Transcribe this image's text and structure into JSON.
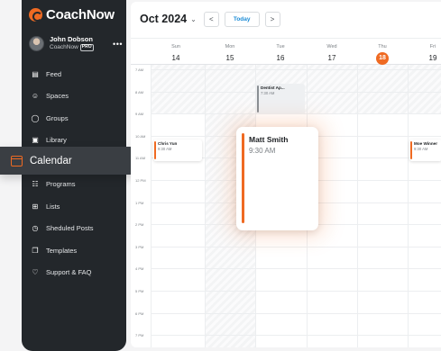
{
  "brand": {
    "name": "CoachNow"
  },
  "profile": {
    "name": "John Dobson",
    "subtitle": "CoachNow",
    "badge": "PRO",
    "menu_glyph": "•••"
  },
  "nav": {
    "items": [
      {
        "label": "Feed",
        "icon": "feed-icon",
        "glyph": "▤"
      },
      {
        "label": "Spaces",
        "icon": "spaces-icon",
        "glyph": "☺"
      },
      {
        "label": "Groups",
        "icon": "groups-icon",
        "glyph": "◯"
      },
      {
        "label": "Library",
        "icon": "library-icon",
        "glyph": "▣"
      },
      {
        "label": "Calendar",
        "icon": "calendar-icon",
        "glyph": ""
      },
      {
        "label": "Programs",
        "icon": "programs-icon",
        "glyph": "☷"
      },
      {
        "label": "Lists",
        "icon": "lists-icon",
        "glyph": "⊞"
      },
      {
        "label": "Sheduled Posts",
        "icon": "scheduled-posts-icon",
        "glyph": "◷"
      },
      {
        "label": "Templates",
        "icon": "templates-icon",
        "glyph": "❐"
      },
      {
        "label": "Support & FAQ",
        "icon": "support-icon",
        "glyph": "♡"
      }
    ],
    "active_label": "Calendar"
  },
  "calendar": {
    "month": "Oct 2024",
    "month_chevron": "⌄",
    "prev_glyph": "<",
    "next_glyph": ">",
    "today_label": "Today",
    "days": [
      {
        "name": "Sun",
        "num": "14"
      },
      {
        "name": "Mon",
        "num": "15"
      },
      {
        "name": "Tue",
        "num": "16"
      },
      {
        "name": "Wed",
        "num": "17"
      },
      {
        "name": "Thu",
        "num": "18",
        "today": true
      },
      {
        "name": "Fri",
        "num": "19"
      }
    ],
    "times": [
      "7 AM",
      "8 AM",
      "9 AM",
      "10 AM",
      "11 AM",
      "12 PM",
      "1 PM",
      "2 PM",
      "3 PM",
      "4 PM",
      "5 PM",
      "6 PM",
      "7 PM"
    ],
    "events": [
      {
        "title": "Dentist Ap...",
        "time": "7:30 AM",
        "style": "grey"
      },
      {
        "title": "Chris Yun",
        "time": "9:30 AM",
        "style": "white"
      },
      {
        "title": "Moe Winner",
        "time": "9:30 AM",
        "style": "white"
      }
    ],
    "featured_event": {
      "title": "Matt Smith",
      "time": "9:30 AM"
    }
  },
  "colors": {
    "accent": "#ef6a22",
    "sidebar": "#23272b",
    "today_link": "#1a8bd6"
  }
}
